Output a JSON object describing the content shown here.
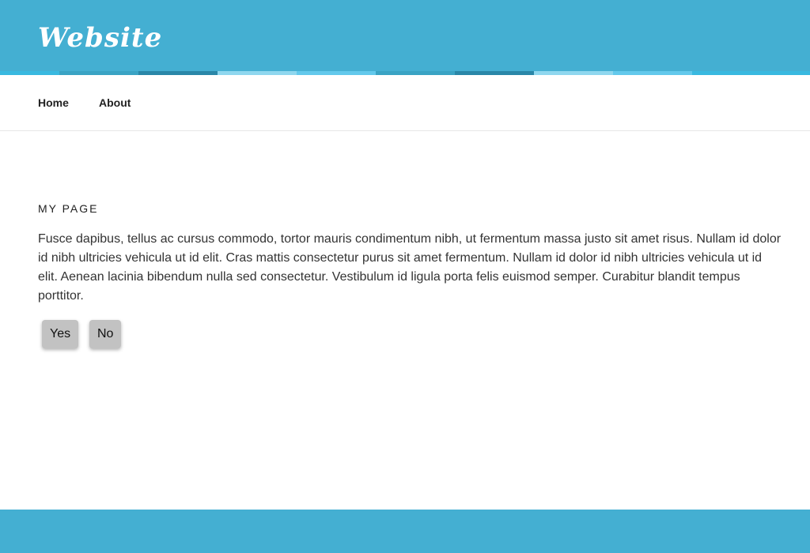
{
  "header": {
    "site_title": "Website",
    "background_color": "#44afd2",
    "strip_colors": [
      "#39b9e0",
      "#3aa3c4",
      "#2a87a8",
      "#8fd7ef",
      "#63c9ec",
      "#3aa3c4",
      "#2a87a8",
      "#8fd7ef",
      "#63c9ec",
      "#39b9e0",
      "#39b9e0"
    ]
  },
  "nav": {
    "items": [
      {
        "label": "Home"
      },
      {
        "label": "About"
      }
    ]
  },
  "main": {
    "title": "My Page",
    "body": "Fusce dapibus, tellus ac cursus commodo, tortor mauris condimentum nibh, ut fermentum massa justo sit amet risus. Nullam id dolor id nibh ultricies vehicula ut id elit. Cras mattis consectetur purus sit amet fermentum. Nullam id dolor id nibh ultricies vehicula ut id elit. Aenean lacinia bibendum nulla sed consectetur. Vestibulum id ligula porta felis euismod semper. Curabitur blandit tempus porttitor.",
    "buttons": {
      "yes_label": "Yes",
      "no_label": "No"
    }
  },
  "footer": {
    "background_color": "#44afd2"
  }
}
